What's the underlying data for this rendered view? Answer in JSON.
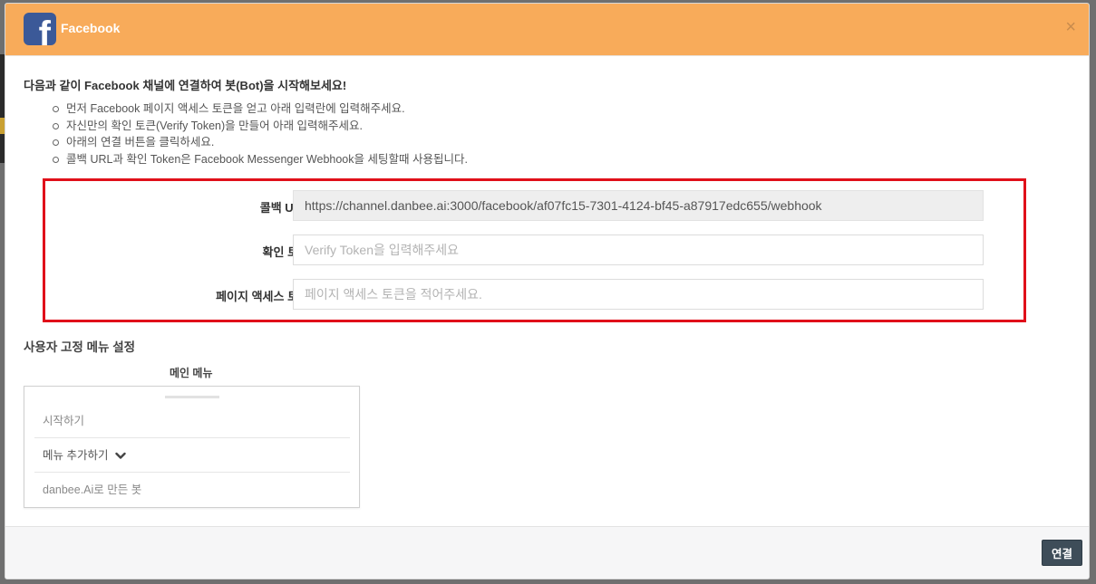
{
  "header": {
    "title": "Facebook",
    "logo_letter": "f",
    "close_label": "×"
  },
  "intro": {
    "title": "다음과 같이 Facebook 채널에 연결하여 봇(Bot)을 시작해보세요!",
    "items": [
      "먼저 Facebook 페이지 액세스 토큰을 얻고 아래 입력란에 입력해주세요.",
      "자신만의 확인 토큰(Verify Token)을 만들어 아래 입력해주세요.",
      "아래의 연결 버튼을 클릭하세요.",
      "콜백 URL과 확인 Token은 Facebook Messenger Webhook을 세팅할때 사용됩니다."
    ]
  },
  "form": {
    "callback_label": "콜백 URL",
    "callback_value": "https://channel.danbee.ai:3000/facebook/af07fc15-7301-4124-bf45-a87917edc655/webhook",
    "verify_label": "확인 토큰",
    "verify_placeholder": "Verify Token을 입력해주세요",
    "access_label": "페이지 액세스 토큰",
    "access_placeholder": "페이지 액세스 토큰을 적어주세요."
  },
  "menu": {
    "section_title": "사용자 고정 메뉴 설정",
    "column_title": "메인 메뉴",
    "items": [
      "시작하기",
      "메뉴 추가하기",
      "danbee.Ai로 만든 봇"
    ]
  },
  "footer": {
    "connect_label": "연결"
  },
  "colors": {
    "header_bg": "#f8ab5a",
    "facebook_blue": "#3b5998",
    "highlight_red": "#e0101a",
    "button_bg": "#3e4d59"
  }
}
